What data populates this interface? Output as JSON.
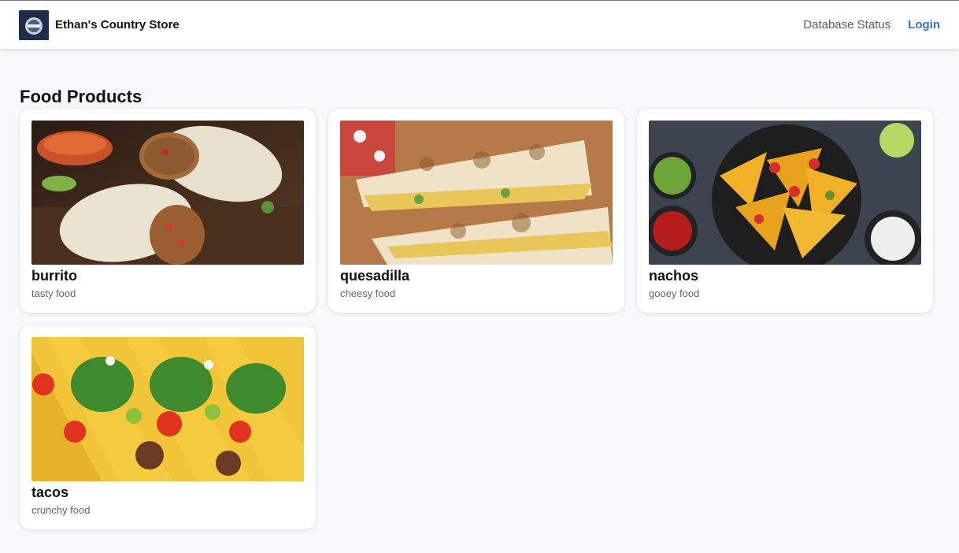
{
  "navbar": {
    "brand": "Ethan's Country Store",
    "links": [
      {
        "label": "Database Status"
      },
      {
        "label": "Login"
      }
    ]
  },
  "main": {
    "title": "Food Products",
    "products": [
      {
        "name": "burrito",
        "description": "tasty food",
        "image": "burrito-photo"
      },
      {
        "name": "quesadilla",
        "description": "cheesy food",
        "image": "quesadilla-photo"
      },
      {
        "name": "nachos",
        "description": "gooey food",
        "image": "nachos-photo"
      },
      {
        "name": "tacos",
        "description": "crunchy food",
        "image": "tacos-photo"
      }
    ]
  },
  "colors": {
    "accent": "#2f79c5",
    "page_bg": "#f8f9fb"
  }
}
